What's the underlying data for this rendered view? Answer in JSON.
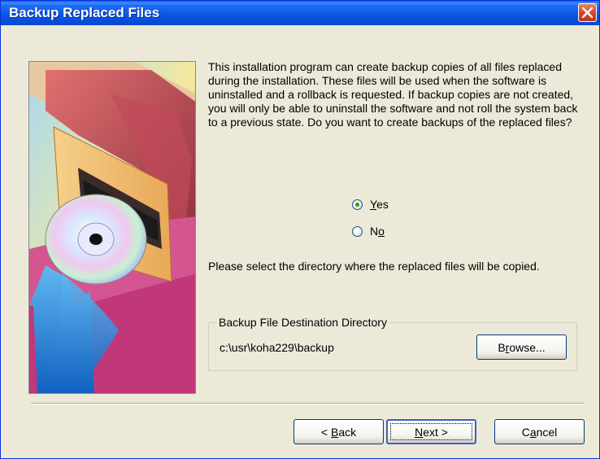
{
  "window": {
    "title": "Backup Replaced Files"
  },
  "description": "This installation program can create backup copies of all files replaced during the installation. These files will be used when the software is uninstalled and a rollback is requested.  If backup copies are not created, you will only be able to uninstall the software and not roll the system back to a previous state. Do you want to create backups of the replaced files?",
  "options": {
    "yes": {
      "label_first": "Y",
      "label_rest": "es",
      "checked": true
    },
    "no": {
      "label_first": "N",
      "label_u": "o",
      "checked": false
    }
  },
  "select_directory_text": "Please select the directory where the replaced  files will be copied.",
  "groupbox": {
    "legend": "Backup File Destination Directory",
    "path": "c:\\usr\\koha229\\backup",
    "browse_first": "B",
    "browse_u": "r",
    "browse_rest": "owse..."
  },
  "buttons": {
    "back_prefix": "< ",
    "back_u": "B",
    "back_rest": "ack",
    "next_u": "N",
    "next_rest": "ext >",
    "cancel_first": "C",
    "cancel_u": "a",
    "cancel_rest": "ncel"
  },
  "icons": [
    "close-icon",
    "installer-cd-illustration"
  ],
  "colors": {
    "titlebar": "#0a55e3",
    "dialog_bg": "#ece9d8",
    "close_button": "#d8462a"
  }
}
